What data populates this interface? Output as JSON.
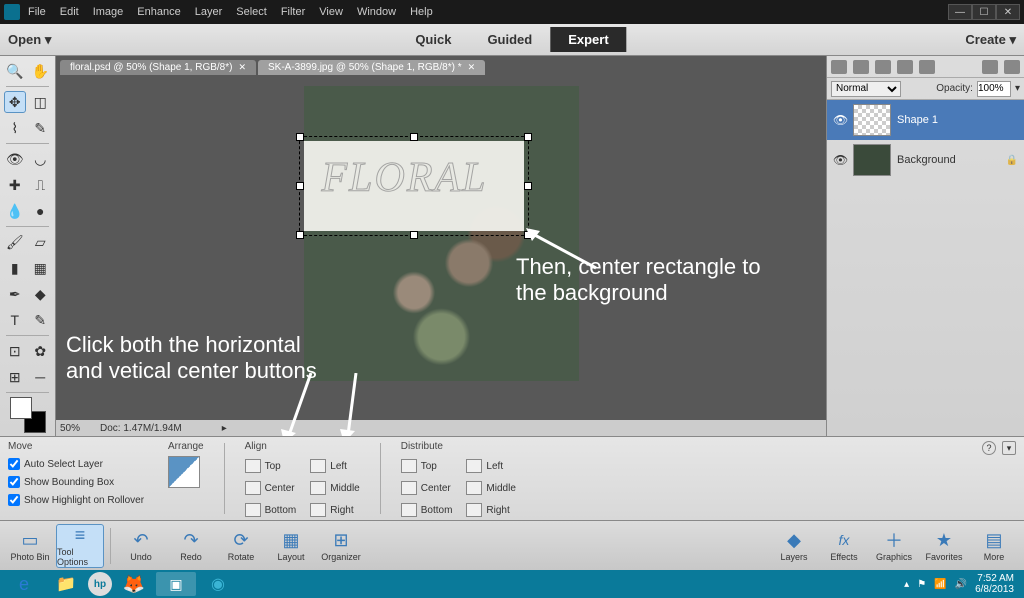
{
  "menubar": [
    "File",
    "Edit",
    "Image",
    "Enhance",
    "Layer",
    "Select",
    "Filter",
    "View",
    "Window",
    "Help"
  ],
  "optionbar": {
    "open": "Open",
    "modes": [
      "Quick",
      "Guided",
      "Expert"
    ],
    "create": "Create"
  },
  "tabs": [
    {
      "label": "floral.psd @ 50% (Shape 1, RGB/8*)",
      "active": false
    },
    {
      "label": "SK-A-3899.jpg @ 50% (Shape 1, RGB/8*) *",
      "active": true
    }
  ],
  "annotations": {
    "a1_l1": "Then, center rectangle to",
    "a1_l2": "the background",
    "a2_l1": "Click both the horizontal",
    "a2_l2": "and vetical center buttons"
  },
  "floral_text": "FLORAL",
  "status": {
    "zoom": "50%",
    "doc": "Doc: 1.47M/1.94M"
  },
  "layerspanel": {
    "blend": "Normal",
    "opacity_label": "Opacity:",
    "opacity": "100%",
    "layers": [
      {
        "name": "Shape 1",
        "selected": true,
        "bg": false
      },
      {
        "name": "Background",
        "selected": false,
        "bg": true
      }
    ]
  },
  "options": {
    "tool": "Move",
    "checks": [
      "Auto Select Layer",
      "Show Bounding Box",
      "Show Highlight on Rollover"
    ],
    "groups": {
      "arrange": "Arrange",
      "align": "Align",
      "distribute": "Distribute"
    },
    "alignV": [
      "Top",
      "Center",
      "Bottom"
    ],
    "alignH": [
      "Left",
      "Middle",
      "Right"
    ],
    "distV": [
      "Top",
      "Center",
      "Bottom"
    ],
    "distH": [
      "Left",
      "Middle",
      "Right"
    ]
  },
  "bottombar": [
    {
      "id": "photo-bin",
      "label": "Photo Bin",
      "icon": "▭"
    },
    {
      "id": "tool-options",
      "label": "Tool Options",
      "icon": "≡",
      "sel": true
    },
    {
      "id": "undo",
      "label": "Undo",
      "icon": "↶"
    },
    {
      "id": "redo",
      "label": "Redo",
      "icon": "↷"
    },
    {
      "id": "rotate",
      "label": "Rotate",
      "icon": "⟳"
    },
    {
      "id": "layout",
      "label": "Layout",
      "icon": "▦"
    },
    {
      "id": "organizer",
      "label": "Organizer",
      "icon": "⊞"
    }
  ],
  "bottombar_right": [
    {
      "id": "layers",
      "label": "Layers",
      "icon": "◆"
    },
    {
      "id": "effects",
      "label": "Effects",
      "icon": "fx"
    },
    {
      "id": "graphics",
      "label": "Graphics",
      "icon": "＋"
    },
    {
      "id": "favorites",
      "label": "Favorites",
      "icon": "★"
    },
    {
      "id": "more",
      "label": "More",
      "icon": "▤"
    }
  ],
  "tray": {
    "time": "7:52 AM",
    "date": "6/8/2013"
  }
}
